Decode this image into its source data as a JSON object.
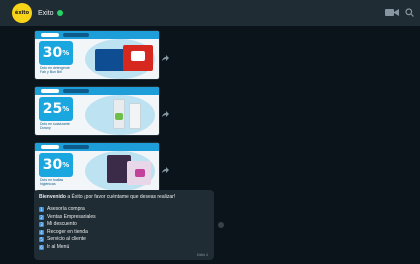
{
  "header": {
    "avatar_text": "éxito",
    "contact_name": "Exito",
    "icons": [
      "video-icon",
      "search-icon"
    ]
  },
  "promos": [
    {
      "percent": "30",
      "desc": "Dcto en detergente Fab y Bon Bril",
      "accent": "#1aa6df"
    },
    {
      "percent": "25",
      "desc": "Dcto en suavizante Downy",
      "accent": "#1aa6df"
    },
    {
      "percent": "30",
      "desc": "Dcto en toallas higiénicas",
      "accent": "#1aa6df"
    }
  ],
  "welcome": {
    "intro_bold": "Bienvenido",
    "intro_rest": " a Éxito ¡por favor cuéntame que deseas realizar!",
    "items": [
      {
        "num": "1",
        "label": "Asesoría compra"
      },
      {
        "num": "2",
        "label": "Ventas Empresariales"
      },
      {
        "num": "3",
        "label": "Mi descuento"
      },
      {
        "num": "4",
        "label": "Recoger en tienda"
      },
      {
        "num": "5",
        "label": "Servicio al cliente"
      },
      {
        "num": "6",
        "label": "Ir al Menú"
      }
    ],
    "time": "Editó 4"
  },
  "colors": {
    "header_bg": "#202c33",
    "chat_bg": "#0b141a",
    "accent_green": "#25d366",
    "brand_yellow": "#f7d417"
  }
}
